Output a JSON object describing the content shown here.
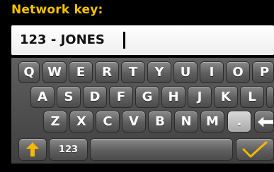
{
  "header": {
    "title": "Network key:"
  },
  "entry": {
    "value": "123 - JONES "
  },
  "keyboard": {
    "row1": [
      "Q",
      "W",
      "E",
      "R",
      "T",
      "Y",
      "U",
      "I",
      "O",
      "P"
    ],
    "row2": [
      "A",
      "S",
      "D",
      "F",
      "G",
      "H",
      "J",
      "K",
      "L"
    ],
    "row3": [
      "Z",
      "X",
      "C",
      "V",
      "B",
      "N",
      "M",
      "."
    ],
    "mode_label": "123"
  },
  "icons": {
    "shift": "arrow-up-icon",
    "backspace": "arrow-left-icon",
    "confirm": "checkmark-icon"
  },
  "colors": {
    "title": "#f6c200",
    "shift_arrow": "#f6b800",
    "checkmark": "#f6b800"
  }
}
